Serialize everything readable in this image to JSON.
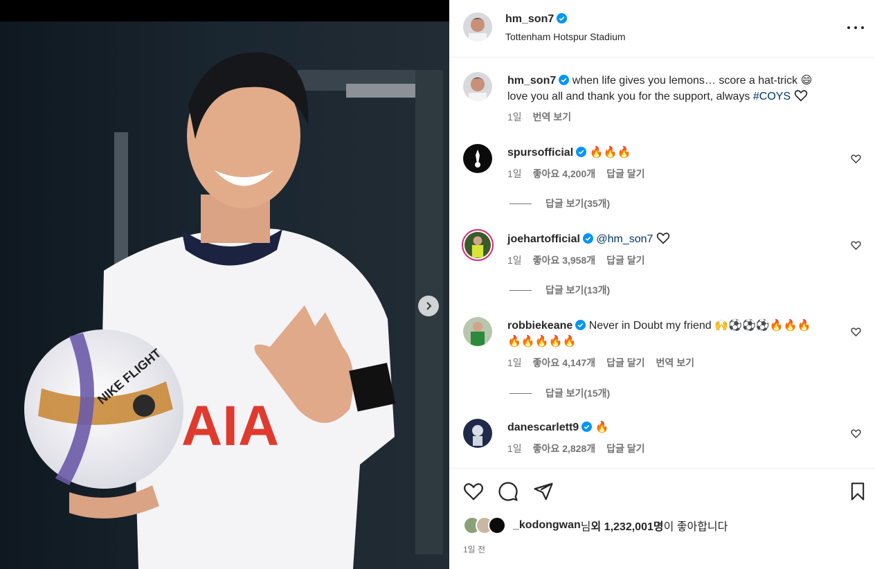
{
  "header": {
    "username": "hm_son7",
    "location": "Tottenham Hotspur Stadium"
  },
  "caption": {
    "username": "hm_son7",
    "line1": "when life gives you lemons… score a hat-trick 😄",
    "line2": "love you all and thank you for the support, always",
    "hashtag": "#COYS",
    "time": "1일",
    "translate": "번역 보기"
  },
  "comments": [
    {
      "username": "spursofficial",
      "text": "🔥🔥🔥",
      "time": "1일",
      "likes": "좋아요 4,200개",
      "reply": "답글 달기",
      "view_replies": "답글 보기(35개)"
    },
    {
      "username": "joehartofficial",
      "mention": "@hm_son7",
      "text": "",
      "time": "1일",
      "likes": "좋아요 3,958개",
      "reply": "답글 달기",
      "view_replies": "답글 보기(13개)"
    },
    {
      "username": "robbiekeane",
      "text": "Never in Doubt my friend 🙌⚽⚽⚽🔥🔥🔥",
      "text2": "🔥🔥🔥🔥🔥",
      "time": "1일",
      "likes": "좋아요 4,147개",
      "reply": "답글 달기",
      "translate": "번역 보기",
      "view_replies": "답글 보기(15개)"
    },
    {
      "username": "danescarlett9",
      "text": "🔥",
      "time": "1일",
      "likes": "좋아요 2,828개",
      "reply": "답글 달기"
    }
  ],
  "likes_line": {
    "user": "_kodongwan",
    "suffix_a": "님 ",
    "others": "외 1,232,001명",
    "suffix_b": "이 좋아합니다"
  },
  "post_time": "1일 전",
  "colors": {
    "accent": "#0095f6",
    "link": "#00376b",
    "verified": "#0095f6"
  },
  "icons": [
    "verified-icon",
    "more-icon",
    "heart-icon",
    "comment-icon",
    "share-icon",
    "bookmark-icon",
    "chevron-right-icon"
  ]
}
